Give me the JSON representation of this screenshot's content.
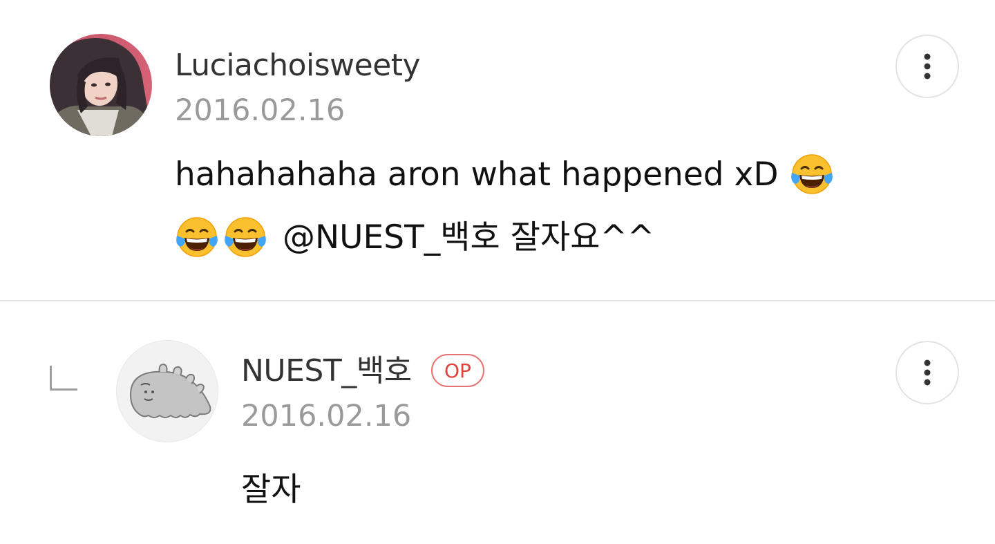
{
  "comments": [
    {
      "username": "Luciachoisweety",
      "date": "2016.02.16",
      "line1_text": "hahahahaha aron what happened xD",
      "line2_text": "@NUEST_백호 잘자요^^",
      "emoji": "face-with-tears-of-joy-icon",
      "more_icon": "more-vertical-icon"
    },
    {
      "username": "NUEST_백호",
      "badge": "OP",
      "date": "2016.02.16",
      "text": "잘자",
      "reply_icon": "reply-indicator-icon",
      "more_icon": "more-vertical-icon"
    }
  ],
  "colors": {
    "username": "#333333",
    "date": "#9a9a9a",
    "body": "#111111",
    "op_badge": "#e0443c",
    "divider": "#e4e4e4"
  }
}
